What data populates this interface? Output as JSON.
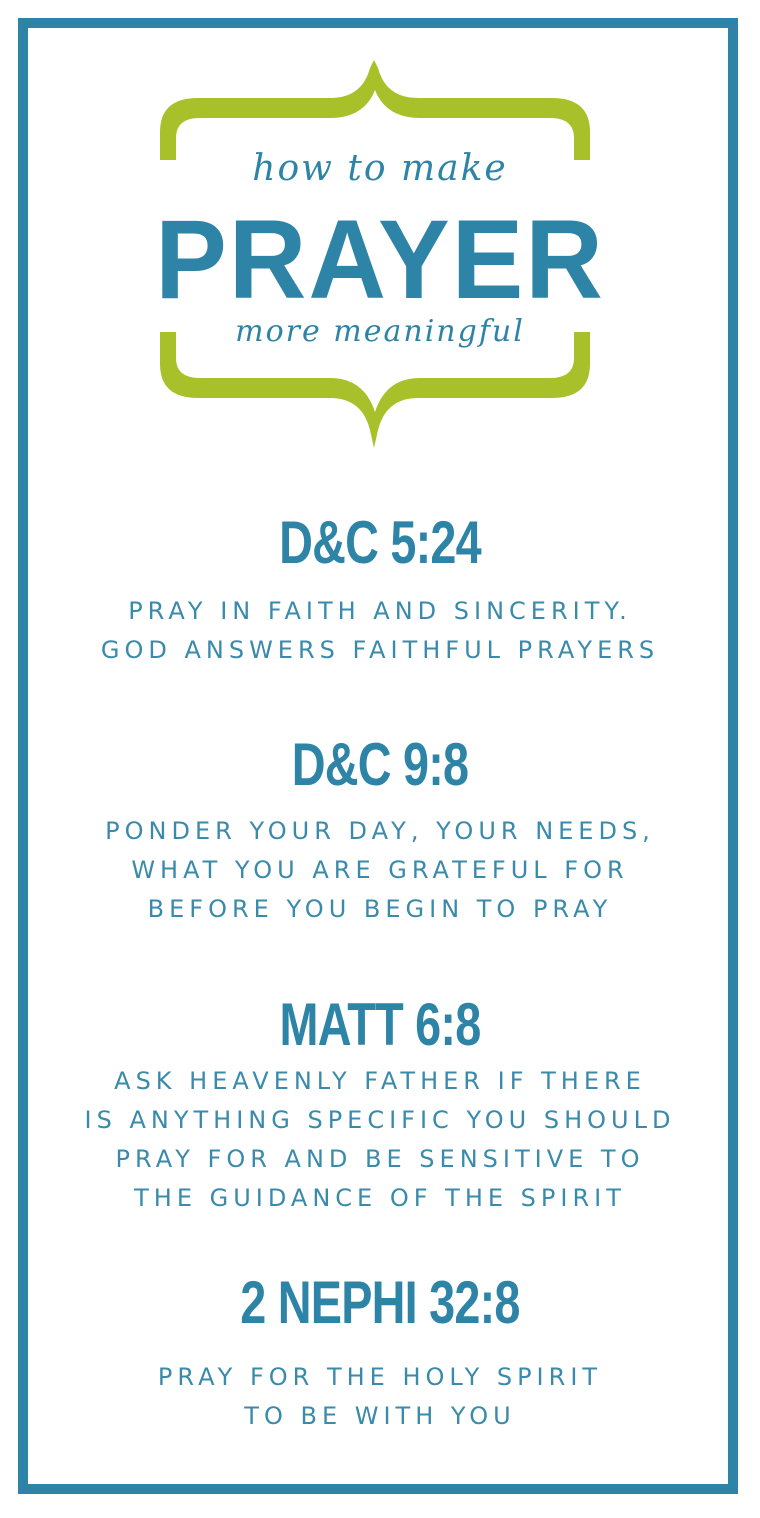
{
  "header": {
    "line1": "how to make",
    "title": "PRAYER",
    "line2": "more meaningful"
  },
  "colors": {
    "primary": "#2e84a6",
    "accent": "#a8c02a"
  },
  "sections": [
    {
      "reference": "D&C 5:24",
      "lines": [
        "PRAY IN FAITH AND SINCERITY.",
        "GOD ANSWERS FAITHFUL PRAYERS"
      ]
    },
    {
      "reference": "D&C 9:8",
      "lines": [
        "PONDER YOUR DAY, YOUR NEEDS,",
        "WHAT YOU ARE GRATEFUL FOR",
        "BEFORE YOU BEGIN TO PRAY"
      ]
    },
    {
      "reference": "MATT 6:8",
      "lines": [
        "ASK HEAVENLY FATHER IF THERE",
        "IS ANYTHING SPECIFIC YOU SHOULD",
        "PRAY FOR AND BE SENSITIVE TO",
        "THE GUIDANCE OF THE SPIRIT"
      ]
    },
    {
      "reference": "2 NEPHI 32:8",
      "lines": [
        "PRAY FOR THE HOLY SPIRIT",
        "TO BE WITH YOU"
      ]
    }
  ]
}
